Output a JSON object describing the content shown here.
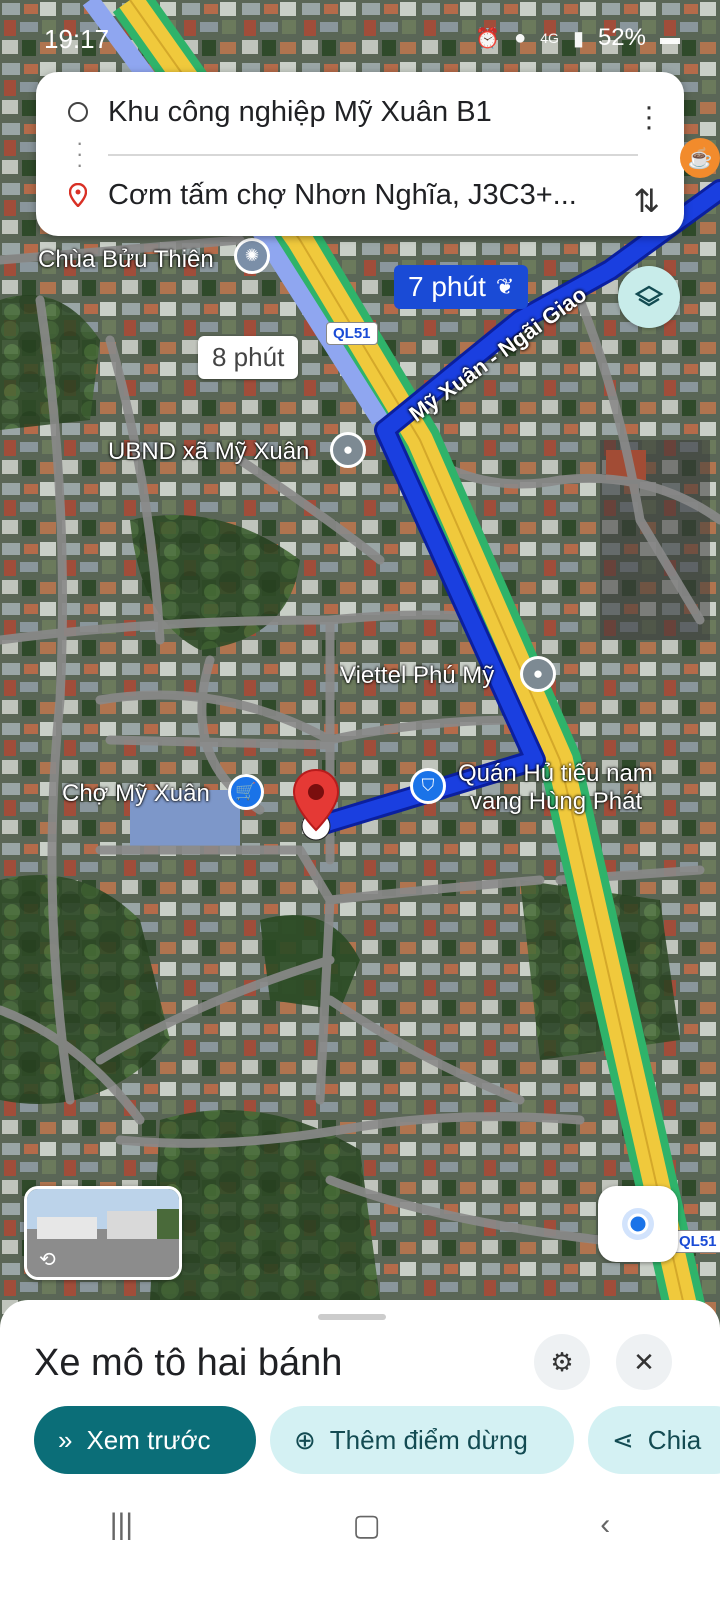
{
  "status_bar": {
    "time": "19:17",
    "battery": "52%",
    "network": "4G"
  },
  "route_card": {
    "origin": "Khu công nghiệp Mỹ Xuân B1",
    "destination": "Cơm tấm chợ Nhơn Nghĩa, J3C3+..."
  },
  "map": {
    "eta_primary": "7 phút",
    "eta_alternate": "8 phút",
    "road_name": "Mỹ Xuân - Ngãi Giao",
    "highway_shield": "QL51",
    "highway_shield_bottom": "QL51",
    "labels": {
      "chua": "Chùa Bửu Thiên",
      "ubnd": "UBND xã Mỹ Xuân",
      "viettel": "Viettel Phú Mỹ",
      "cho": "Chợ Mỹ Xuân",
      "quan_line1": "Quán Hủ tiếu nam",
      "quan_line2": "vang Hùng Phát"
    },
    "colors": {
      "route": "#1a3fe0",
      "alt_route": "#8fa6f0",
      "highway": "#f0c93c",
      "highway_edge": "#2fb36a"
    }
  },
  "bottom_sheet": {
    "title": "Xe mô tô hai bánh",
    "preview_label": "Xem trước",
    "add_stop_label": "Thêm điểm dừng",
    "share_label": "Chia"
  }
}
